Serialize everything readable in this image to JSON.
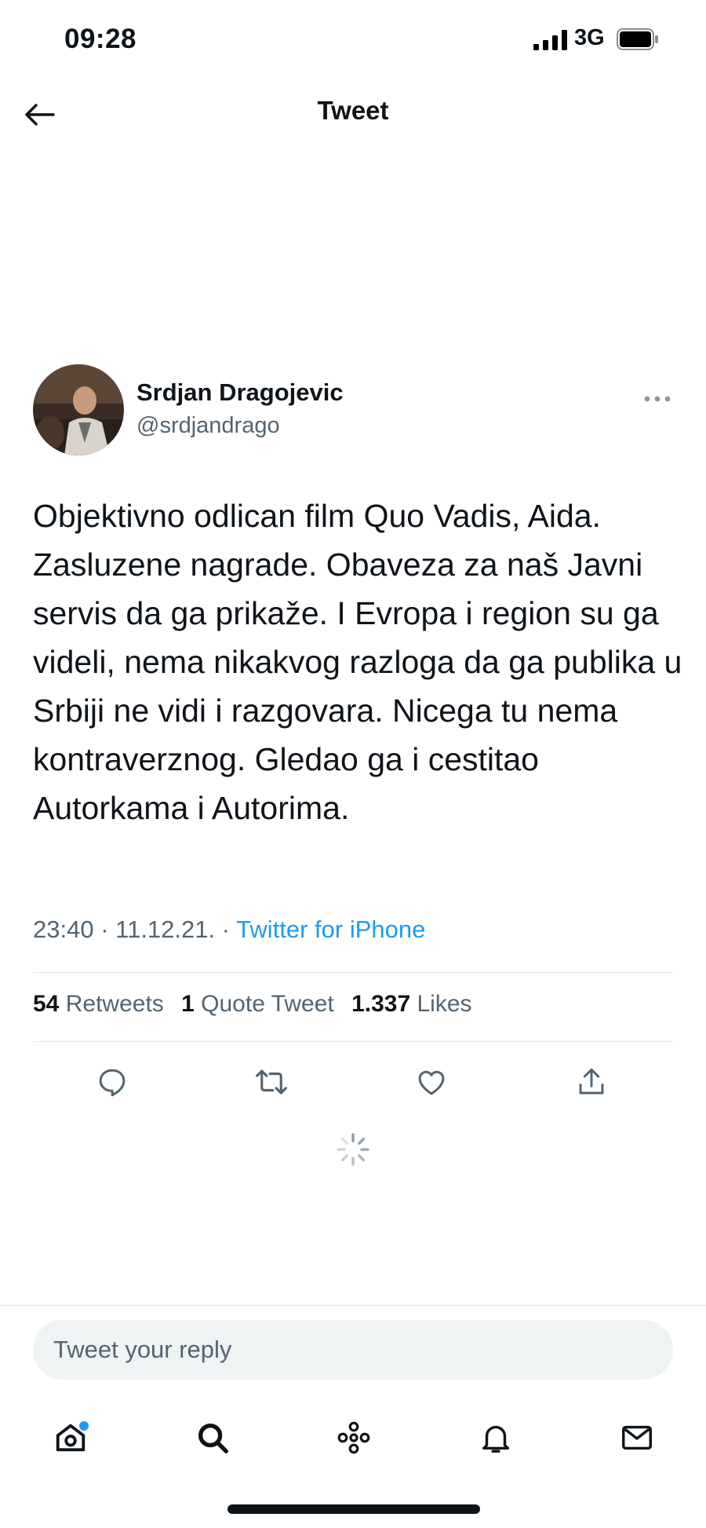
{
  "status_bar": {
    "time": "09:28",
    "network": "3G"
  },
  "header": {
    "title": "Tweet"
  },
  "author": {
    "name": "Srdjan Dragojevic",
    "handle": "@srdjandrago"
  },
  "tweet": {
    "text": "Objektivno odlican film Quo Vadis, Aida. Zasluzene nagrade. Obaveza za naš Javni servis da ga prikaže. I Evropa i region su ga videli, nema nikakvog razloga da ga publika u Srbiji ne vidi i razgovara. Nicega tu nema kontraverznog. Gledao ga i cestitao Autorkama i Autorima.",
    "time": "23:40",
    "date": "11.12.21.",
    "source": "Twitter for iPhone"
  },
  "stats": {
    "retweets_count": "54",
    "retweets_label": "Retweets",
    "quotes_count": "1",
    "quotes_label": "Quote Tweet",
    "likes_count": "1.337",
    "likes_label": "Likes"
  },
  "reply": {
    "placeholder": "Tweet your reply"
  },
  "tab_bar": {
    "items": [
      "home-icon",
      "search-icon",
      "spaces-icon",
      "bell-icon",
      "mail-icon"
    ],
    "home_has_dot": true
  },
  "colors": {
    "accent": "#1d9bf0",
    "text_primary": "#0f1419",
    "text_secondary": "#536471",
    "divider": "#e1e8ed",
    "reply_bg": "#eff3f4"
  }
}
